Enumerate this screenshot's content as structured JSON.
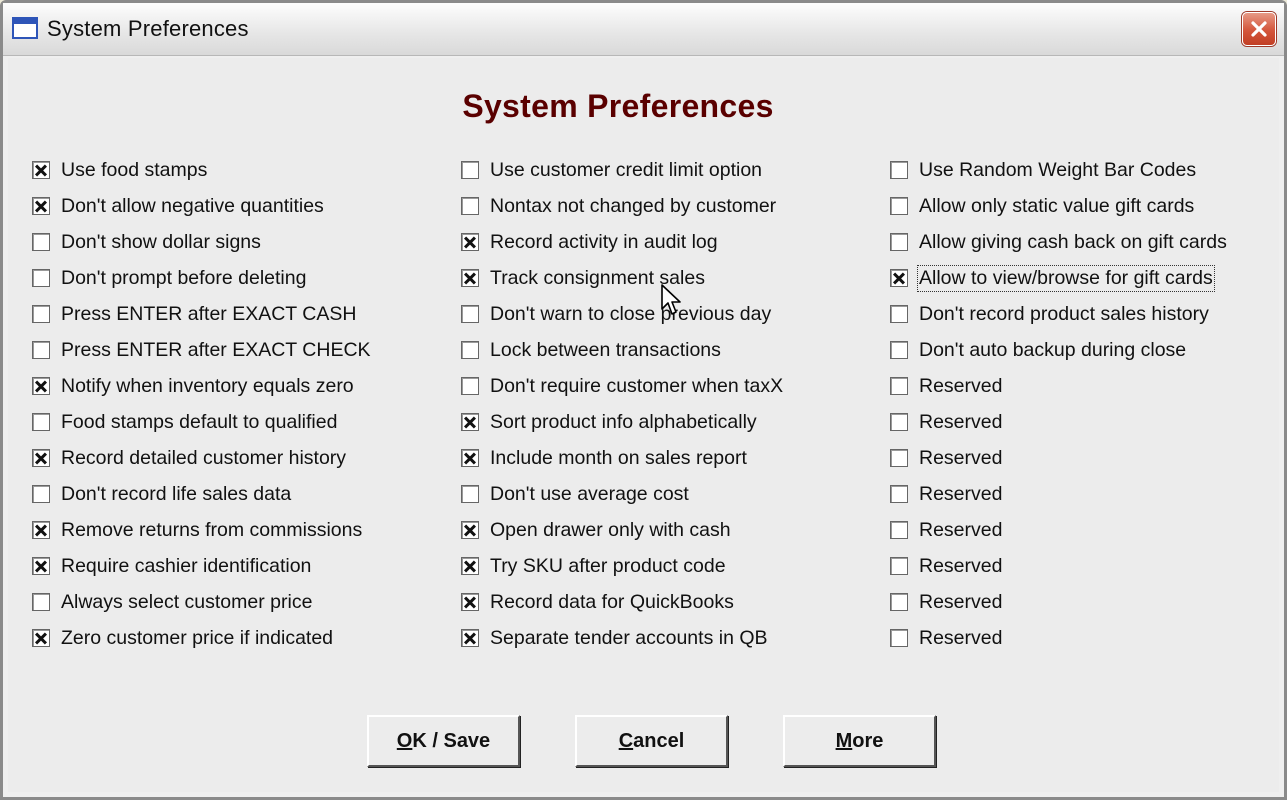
{
  "window": {
    "title": "System Preferences",
    "icon": "window-app-icon",
    "close_icon": "close-icon"
  },
  "heading": "System Preferences",
  "columns": [
    [
      {
        "label": "Use food stamps",
        "checked": true
      },
      {
        "label": "Don't allow negative quantities",
        "checked": true
      },
      {
        "label": "Don't show dollar signs",
        "checked": false
      },
      {
        "label": "Don't prompt before deleting",
        "checked": false
      },
      {
        "label": "Press ENTER after EXACT CASH",
        "checked": false
      },
      {
        "label": "Press ENTER after EXACT CHECK",
        "checked": false
      },
      {
        "label": "Notify when inventory equals zero",
        "checked": true
      },
      {
        "label": "Food stamps default to qualified",
        "checked": false
      },
      {
        "label": "Record detailed customer history",
        "checked": true
      },
      {
        "label": "Don't record life sales data",
        "checked": false
      },
      {
        "label": "Remove returns from commissions",
        "checked": true
      },
      {
        "label": "Require cashier identification",
        "checked": true
      },
      {
        "label": "Always select customer price",
        "checked": false
      },
      {
        "label": "Zero customer price if indicated",
        "checked": true
      }
    ],
    [
      {
        "label": "Use customer credit limit option",
        "checked": false
      },
      {
        "label": "Nontax not changed by customer",
        "checked": false
      },
      {
        "label": "Record activity in audit log",
        "checked": true
      },
      {
        "label": "Track consignment sales",
        "checked": true
      },
      {
        "label": "Don't warn to close previous day",
        "checked": false
      },
      {
        "label": "Lock between transactions",
        "checked": false
      },
      {
        "label": "Don't require customer when taxX",
        "checked": false
      },
      {
        "label": "Sort product info alphabetically",
        "checked": true
      },
      {
        "label": "Include month on sales report",
        "checked": true
      },
      {
        "label": "Don't use average cost",
        "checked": false
      },
      {
        "label": "Open drawer only with cash",
        "checked": true
      },
      {
        "label": "Try SKU after product code",
        "checked": true
      },
      {
        "label": "Record data for QuickBooks",
        "checked": true
      },
      {
        "label": "Separate tender accounts in QB",
        "checked": true
      }
    ],
    [
      {
        "label": "Use Random Weight Bar Codes",
        "checked": false
      },
      {
        "label": "Allow only static value gift cards",
        "checked": false
      },
      {
        "label": "Allow giving cash back on gift cards",
        "checked": false
      },
      {
        "label": "Allow to view/browse for gift cards",
        "checked": true,
        "focused": true
      },
      {
        "label": "Don't record product sales history",
        "checked": false
      },
      {
        "label": "Don't auto backup during close",
        "checked": false
      },
      {
        "label": "Reserved",
        "checked": false
      },
      {
        "label": "Reserved",
        "checked": false
      },
      {
        "label": "Reserved",
        "checked": false
      },
      {
        "label": "Reserved",
        "checked": false
      },
      {
        "label": "Reserved",
        "checked": false
      },
      {
        "label": "Reserved",
        "checked": false
      },
      {
        "label": "Reserved",
        "checked": false
      },
      {
        "label": "Reserved",
        "checked": false
      }
    ]
  ],
  "buttons": {
    "ok": {
      "accel": "O",
      "rest": "K / Save"
    },
    "cancel": {
      "accel": "C",
      "rest": "ancel"
    },
    "more": {
      "accel": "M",
      "rest": "ore"
    }
  },
  "pointer_icon": "mouse-pointer-icon"
}
